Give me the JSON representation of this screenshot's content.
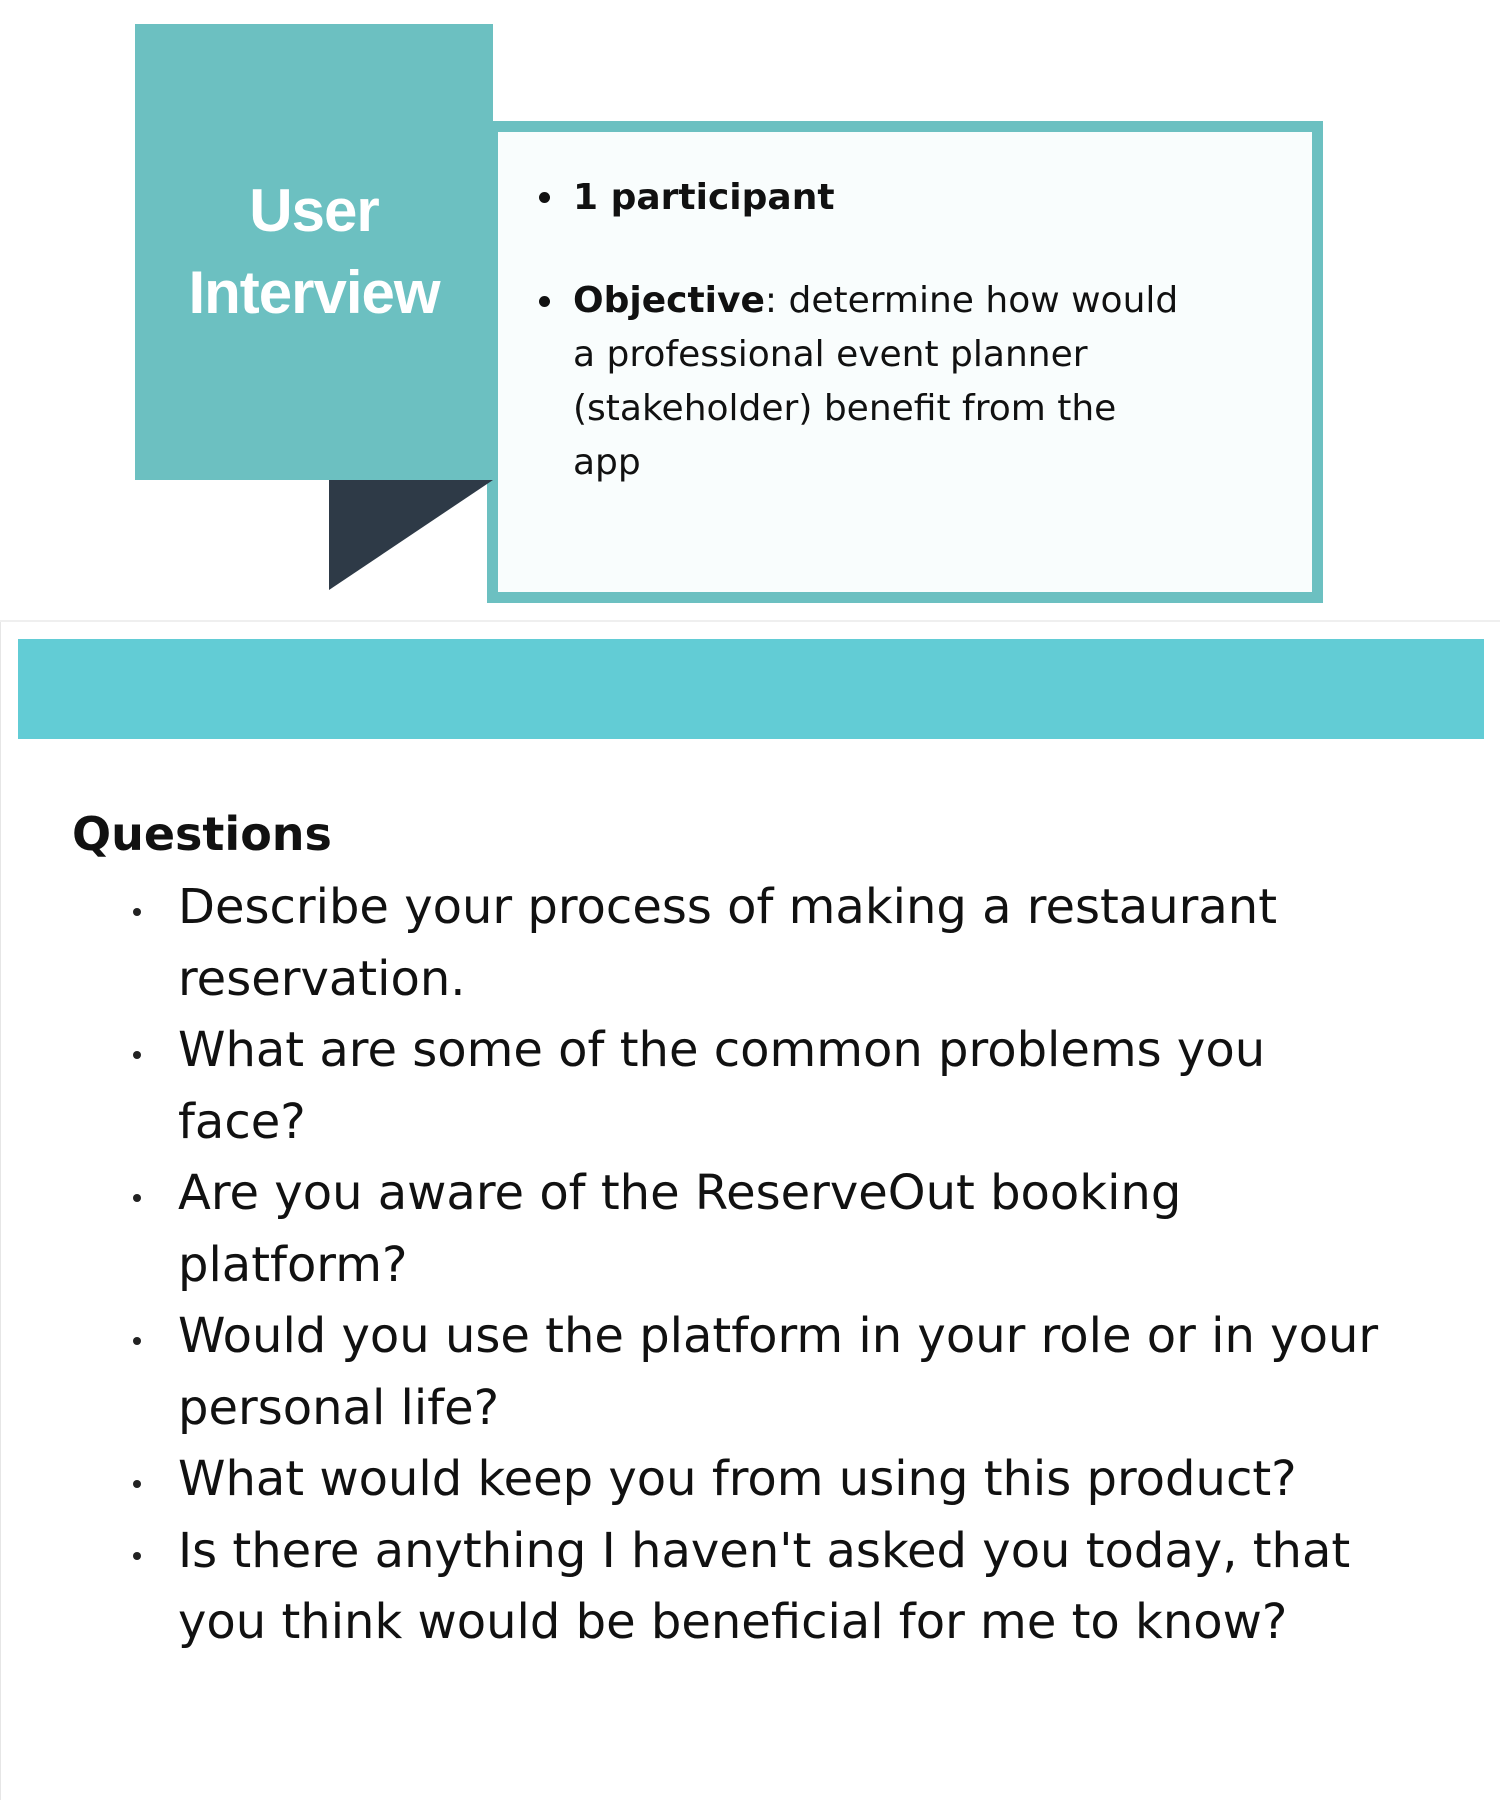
{
  "card": {
    "title_line1": "User",
    "title_line2": "Interview",
    "participants": "1 participant",
    "objective_label": "Objective",
    "objective_text": ": determine how would a professional event planner (stakeholder) benefit from the app"
  },
  "questions": {
    "heading": "Questions",
    "items": [
      "Describe your process of making a restaurant reservation.",
      "What are some of the common problems you face?",
      "Are you aware of the ReserveOut booking platform?",
      "Would you use the platform in your role or in your personal life?",
      "What would keep you from using this product?",
      "Is there anything I haven't asked you today, that you think would be beneficial for me to know?"
    ]
  },
  "colors": {
    "tag_teal": "#6cc0c1",
    "band_teal": "#62ccd5",
    "fold_dark": "#2e3a47"
  }
}
